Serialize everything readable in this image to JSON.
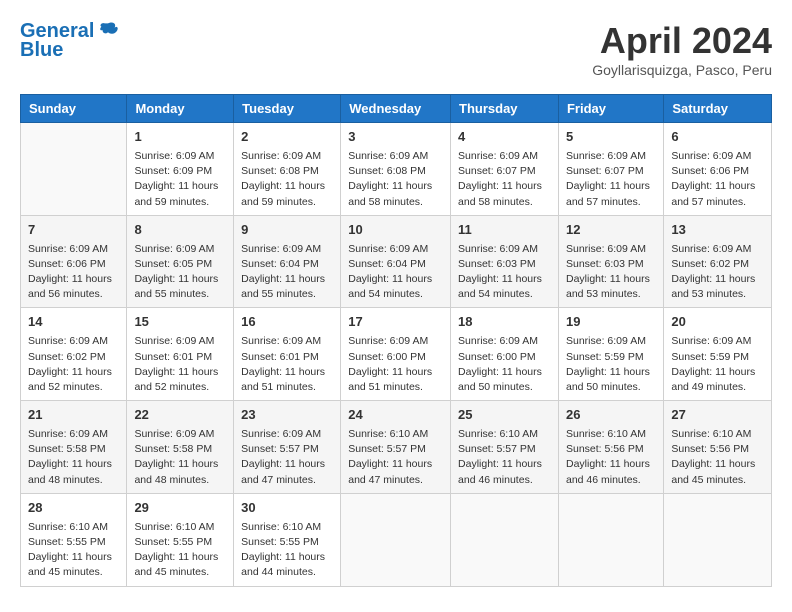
{
  "logo": {
    "line1": "General",
    "line2": "Blue"
  },
  "title": "April 2024",
  "location": "Goyllarisquizga, Pasco, Peru",
  "headers": [
    "Sunday",
    "Monday",
    "Tuesday",
    "Wednesday",
    "Thursday",
    "Friday",
    "Saturday"
  ],
  "weeks": [
    [
      {
        "day": "",
        "sunrise": "",
        "sunset": "",
        "daylight": ""
      },
      {
        "day": "1",
        "sunrise": "Sunrise: 6:09 AM",
        "sunset": "Sunset: 6:09 PM",
        "daylight": "Daylight: 11 hours and 59 minutes."
      },
      {
        "day": "2",
        "sunrise": "Sunrise: 6:09 AM",
        "sunset": "Sunset: 6:08 PM",
        "daylight": "Daylight: 11 hours and 59 minutes."
      },
      {
        "day": "3",
        "sunrise": "Sunrise: 6:09 AM",
        "sunset": "Sunset: 6:08 PM",
        "daylight": "Daylight: 11 hours and 58 minutes."
      },
      {
        "day": "4",
        "sunrise": "Sunrise: 6:09 AM",
        "sunset": "Sunset: 6:07 PM",
        "daylight": "Daylight: 11 hours and 58 minutes."
      },
      {
        "day": "5",
        "sunrise": "Sunrise: 6:09 AM",
        "sunset": "Sunset: 6:07 PM",
        "daylight": "Daylight: 11 hours and 57 minutes."
      },
      {
        "day": "6",
        "sunrise": "Sunrise: 6:09 AM",
        "sunset": "Sunset: 6:06 PM",
        "daylight": "Daylight: 11 hours and 57 minutes."
      }
    ],
    [
      {
        "day": "7",
        "sunrise": "Sunrise: 6:09 AM",
        "sunset": "Sunset: 6:06 PM",
        "daylight": "Daylight: 11 hours and 56 minutes."
      },
      {
        "day": "8",
        "sunrise": "Sunrise: 6:09 AM",
        "sunset": "Sunset: 6:05 PM",
        "daylight": "Daylight: 11 hours and 55 minutes."
      },
      {
        "day": "9",
        "sunrise": "Sunrise: 6:09 AM",
        "sunset": "Sunset: 6:04 PM",
        "daylight": "Daylight: 11 hours and 55 minutes."
      },
      {
        "day": "10",
        "sunrise": "Sunrise: 6:09 AM",
        "sunset": "Sunset: 6:04 PM",
        "daylight": "Daylight: 11 hours and 54 minutes."
      },
      {
        "day": "11",
        "sunrise": "Sunrise: 6:09 AM",
        "sunset": "Sunset: 6:03 PM",
        "daylight": "Daylight: 11 hours and 54 minutes."
      },
      {
        "day": "12",
        "sunrise": "Sunrise: 6:09 AM",
        "sunset": "Sunset: 6:03 PM",
        "daylight": "Daylight: 11 hours and 53 minutes."
      },
      {
        "day": "13",
        "sunrise": "Sunrise: 6:09 AM",
        "sunset": "Sunset: 6:02 PM",
        "daylight": "Daylight: 11 hours and 53 minutes."
      }
    ],
    [
      {
        "day": "14",
        "sunrise": "Sunrise: 6:09 AM",
        "sunset": "Sunset: 6:02 PM",
        "daylight": "Daylight: 11 hours and 52 minutes."
      },
      {
        "day": "15",
        "sunrise": "Sunrise: 6:09 AM",
        "sunset": "Sunset: 6:01 PM",
        "daylight": "Daylight: 11 hours and 52 minutes."
      },
      {
        "day": "16",
        "sunrise": "Sunrise: 6:09 AM",
        "sunset": "Sunset: 6:01 PM",
        "daylight": "Daylight: 11 hours and 51 minutes."
      },
      {
        "day": "17",
        "sunrise": "Sunrise: 6:09 AM",
        "sunset": "Sunset: 6:00 PM",
        "daylight": "Daylight: 11 hours and 51 minutes."
      },
      {
        "day": "18",
        "sunrise": "Sunrise: 6:09 AM",
        "sunset": "Sunset: 6:00 PM",
        "daylight": "Daylight: 11 hours and 50 minutes."
      },
      {
        "day": "19",
        "sunrise": "Sunrise: 6:09 AM",
        "sunset": "Sunset: 5:59 PM",
        "daylight": "Daylight: 11 hours and 50 minutes."
      },
      {
        "day": "20",
        "sunrise": "Sunrise: 6:09 AM",
        "sunset": "Sunset: 5:59 PM",
        "daylight": "Daylight: 11 hours and 49 minutes."
      }
    ],
    [
      {
        "day": "21",
        "sunrise": "Sunrise: 6:09 AM",
        "sunset": "Sunset: 5:58 PM",
        "daylight": "Daylight: 11 hours and 48 minutes."
      },
      {
        "day": "22",
        "sunrise": "Sunrise: 6:09 AM",
        "sunset": "Sunset: 5:58 PM",
        "daylight": "Daylight: 11 hours and 48 minutes."
      },
      {
        "day": "23",
        "sunrise": "Sunrise: 6:09 AM",
        "sunset": "Sunset: 5:57 PM",
        "daylight": "Daylight: 11 hours and 47 minutes."
      },
      {
        "day": "24",
        "sunrise": "Sunrise: 6:10 AM",
        "sunset": "Sunset: 5:57 PM",
        "daylight": "Daylight: 11 hours and 47 minutes."
      },
      {
        "day": "25",
        "sunrise": "Sunrise: 6:10 AM",
        "sunset": "Sunset: 5:57 PM",
        "daylight": "Daylight: 11 hours and 46 minutes."
      },
      {
        "day": "26",
        "sunrise": "Sunrise: 6:10 AM",
        "sunset": "Sunset: 5:56 PM",
        "daylight": "Daylight: 11 hours and 46 minutes."
      },
      {
        "day": "27",
        "sunrise": "Sunrise: 6:10 AM",
        "sunset": "Sunset: 5:56 PM",
        "daylight": "Daylight: 11 hours and 45 minutes."
      }
    ],
    [
      {
        "day": "28",
        "sunrise": "Sunrise: 6:10 AM",
        "sunset": "Sunset: 5:55 PM",
        "daylight": "Daylight: 11 hours and 45 minutes."
      },
      {
        "day": "29",
        "sunrise": "Sunrise: 6:10 AM",
        "sunset": "Sunset: 5:55 PM",
        "daylight": "Daylight: 11 hours and 45 minutes."
      },
      {
        "day": "30",
        "sunrise": "Sunrise: 6:10 AM",
        "sunset": "Sunset: 5:55 PM",
        "daylight": "Daylight: 11 hours and 44 minutes."
      },
      {
        "day": "",
        "sunrise": "",
        "sunset": "",
        "daylight": ""
      },
      {
        "day": "",
        "sunrise": "",
        "sunset": "",
        "daylight": ""
      },
      {
        "day": "",
        "sunrise": "",
        "sunset": "",
        "daylight": ""
      },
      {
        "day": "",
        "sunrise": "",
        "sunset": "",
        "daylight": ""
      }
    ]
  ]
}
